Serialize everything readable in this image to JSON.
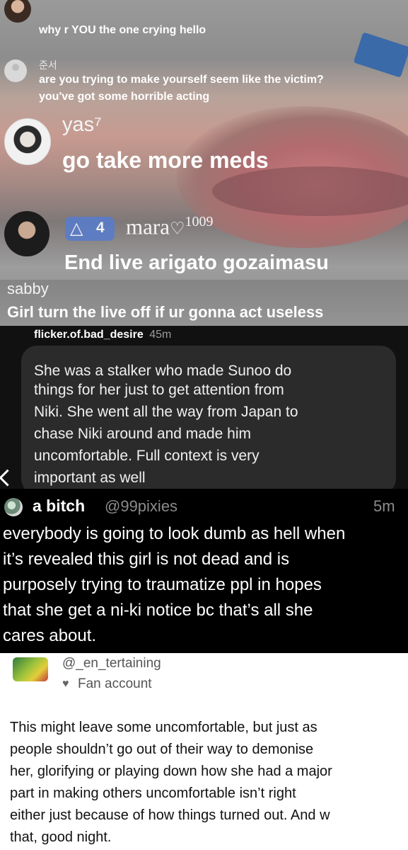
{
  "live": {
    "comments": [
      {
        "name": "",
        "text": "why r YOU the one crying hello"
      },
      {
        "name": "준서",
        "text": "are you trying to make yourself seem like the victim?",
        "text2": "you've got some horrible acting"
      },
      {
        "name": "yas⁷",
        "text": "go take more meds"
      },
      {
        "badge_level": "4",
        "name": "mara",
        "name_suffix": "1009",
        "text": "End live arigato gozaimasu"
      },
      {
        "name": "sabby",
        "text": "Girl turn the live off if ur gonna act useless"
      }
    ]
  },
  "dark_comment": {
    "username": "flicker.of.bad_desire",
    "time": "45m",
    "lines": [
      "She was a stalker who made Sunoo do",
      "things for her just to get attention from",
      "Niki. She went all the way from Japan to",
      "chase Niki around and made him",
      "uncomfortable. Full context is very",
      "important as well"
    ]
  },
  "tweet": {
    "display_name": "a bitch",
    "handle": "@99pixies",
    "time": "5m",
    "lines": [
      "everybody is going to look dumb as hell when",
      "it’s revealed this girl is not dead and is",
      "purposely trying to traumatize ppl in hopes",
      "that she get a ni-ki notice bc that’s all she",
      "cares about."
    ]
  },
  "card": {
    "handle": "@_en_tertaining",
    "account_type": "Fan account",
    "lines": [
      "This might leave some uncomfortable, but just as",
      "people shouldn’t go out of their way to demonise",
      "her, glorifying or playing down how she had a major",
      "part in making others uncomfortable isn’t right",
      "either just because of how things turned out. And w",
      "that, good night."
    ]
  }
}
